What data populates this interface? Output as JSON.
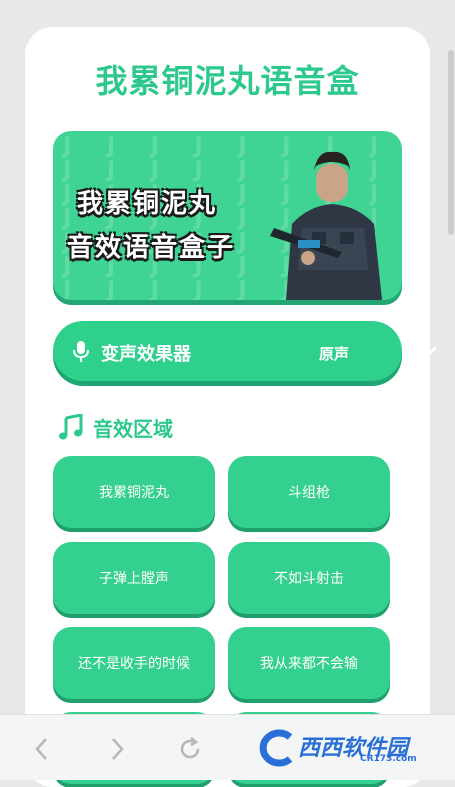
{
  "app": {
    "title": "我累铜泥丸语音盒"
  },
  "banner": {
    "line1": "我累铜泥丸",
    "line2": "音效语音盒子",
    "pattern_glyph": "J"
  },
  "voice_changer": {
    "label": "变声效果器",
    "value": "原声"
  },
  "section": {
    "title": "音效区域"
  },
  "sound_buttons": [
    "我累铜泥丸",
    "斗组枪",
    "子弹上膛声",
    "不如斗射击",
    "还不是收手的时候",
    "我从来都不会输",
    "",
    ""
  ],
  "watermark": {
    "name": "西西软件园",
    "site": "CR173.com"
  },
  "colors": {
    "accent": "#2dc88c",
    "button": "#34d08f",
    "button_shadow": "#1f9f6c",
    "watermark": "#2a6fd6"
  }
}
